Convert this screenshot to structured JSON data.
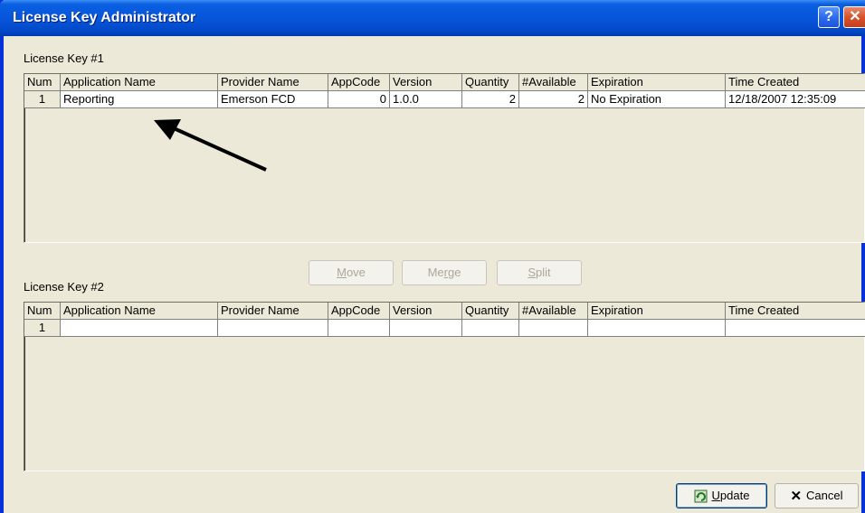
{
  "window": {
    "title": "License Key Administrator",
    "help_label": "?",
    "close_label": "✕"
  },
  "key1": {
    "label": "License Key #1",
    "columns": [
      "Num",
      "Application Name",
      "Provider Name",
      "AppCode",
      "Version",
      "Quantity",
      "#Available",
      "Expiration",
      "Time Created"
    ],
    "rows": [
      {
        "num": "1",
        "app": "Reporting",
        "provider": "Emerson FCD",
        "appcode": "0",
        "version": "1.0.0",
        "quantity": "2",
        "available": "2",
        "expiration": "No Expiration",
        "time": "12/18/2007 12:35:09"
      }
    ]
  },
  "key2": {
    "label": "License Key #2",
    "columns": [
      "Num",
      "Application Name",
      "Provider Name",
      "AppCode",
      "Version",
      "Quantity",
      "#Available",
      "Expiration",
      "Time Created"
    ],
    "rows": [
      {
        "num": "1",
        "app": "",
        "provider": "",
        "appcode": "",
        "version": "",
        "quantity": "",
        "available": "",
        "expiration": "",
        "time": ""
      }
    ]
  },
  "buttons": {
    "move_first": "M",
    "move_rest": "ove",
    "merge_first": "Me",
    "merge_u": "r",
    "merge_rest": "ge",
    "split_first": "S",
    "split_rest": "plit",
    "update_u": "U",
    "update_rest": "pdate",
    "cancel": "Cancel"
  },
  "colors": {
    "titlebar": "#0656dc",
    "face": "#ece9d8",
    "disabled_text": "#aca899",
    "cancel_icon": "#000000"
  }
}
